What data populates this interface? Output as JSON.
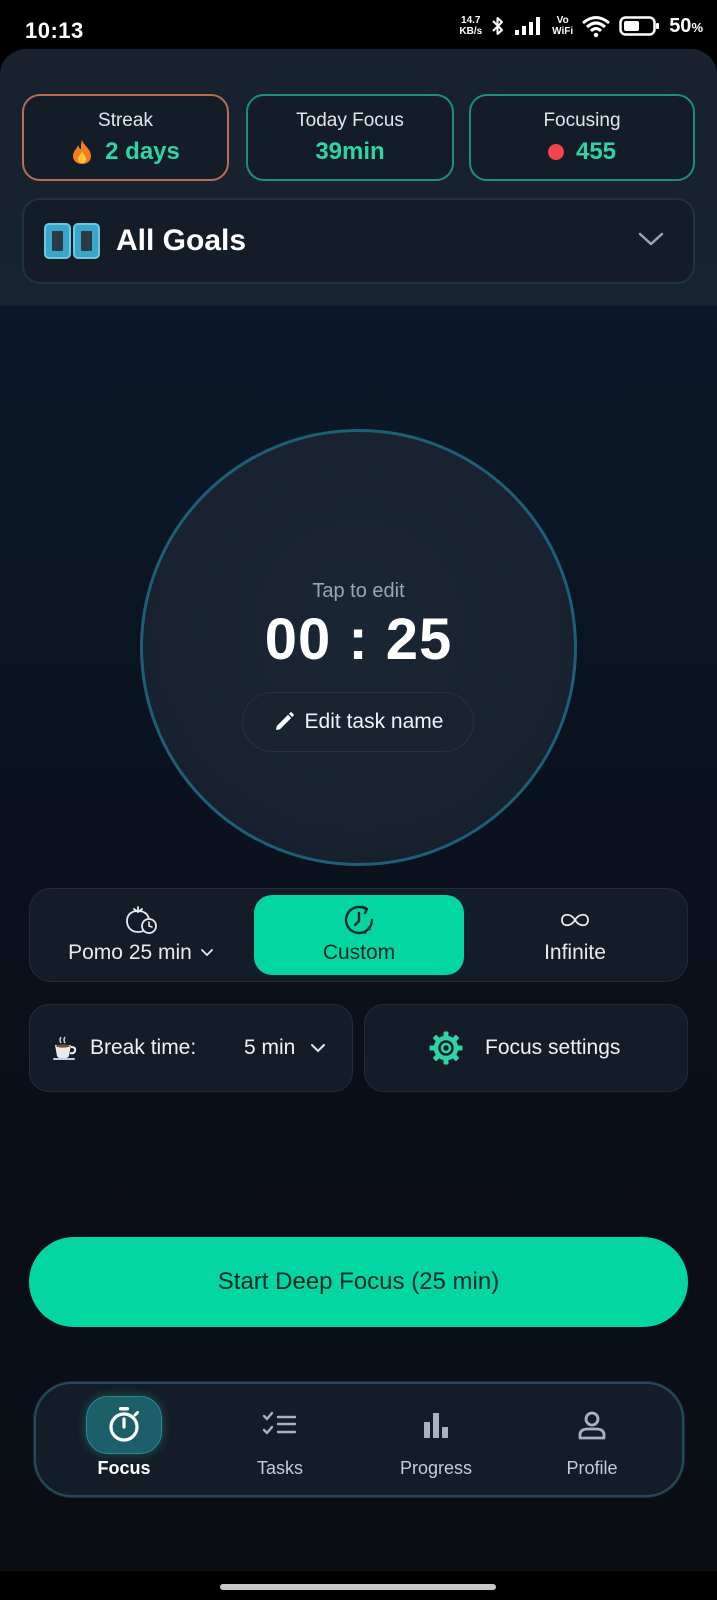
{
  "status_bar": {
    "time": "10:13",
    "net_speed_value": "14.7",
    "net_speed_unit": "KB/s",
    "vowifi_top": "Vo",
    "vowifi_bottom": "WiFi",
    "battery": "50",
    "battery_unit": "%"
  },
  "stats": {
    "streak": {
      "label": "Streak",
      "value": "2 days"
    },
    "today_focus": {
      "label": "Today Focus",
      "value": "39min"
    },
    "focusing": {
      "label": "Focusing",
      "value": "455"
    }
  },
  "goals": {
    "title": "All Goals"
  },
  "timer": {
    "hint": "Tap to edit",
    "value": "00 : 25",
    "edit_task_label": "Edit task name"
  },
  "modes": {
    "pomo": "Pomo 25 min",
    "custom": "Custom",
    "infinite": "Infinite",
    "selected": "custom"
  },
  "break": {
    "label": "Break time:",
    "value": "5 min"
  },
  "settings": {
    "label": "Focus settings"
  },
  "start_button": {
    "label": "Start Deep Focus (25 min)"
  },
  "nav": {
    "items": [
      {
        "label": "Focus",
        "icon": "stopwatch-icon",
        "active": true
      },
      {
        "label": "Tasks",
        "icon": "checklist-icon",
        "active": false
      },
      {
        "label": "Progress",
        "icon": "bar-chart-icon",
        "active": false
      },
      {
        "label": "Profile",
        "icon": "person-icon",
        "active": false
      }
    ]
  },
  "colors": {
    "accent": "#04d6a3",
    "streak_border": "#b56e52",
    "live_dot": "#f0454a",
    "background": "#0b0f18"
  }
}
